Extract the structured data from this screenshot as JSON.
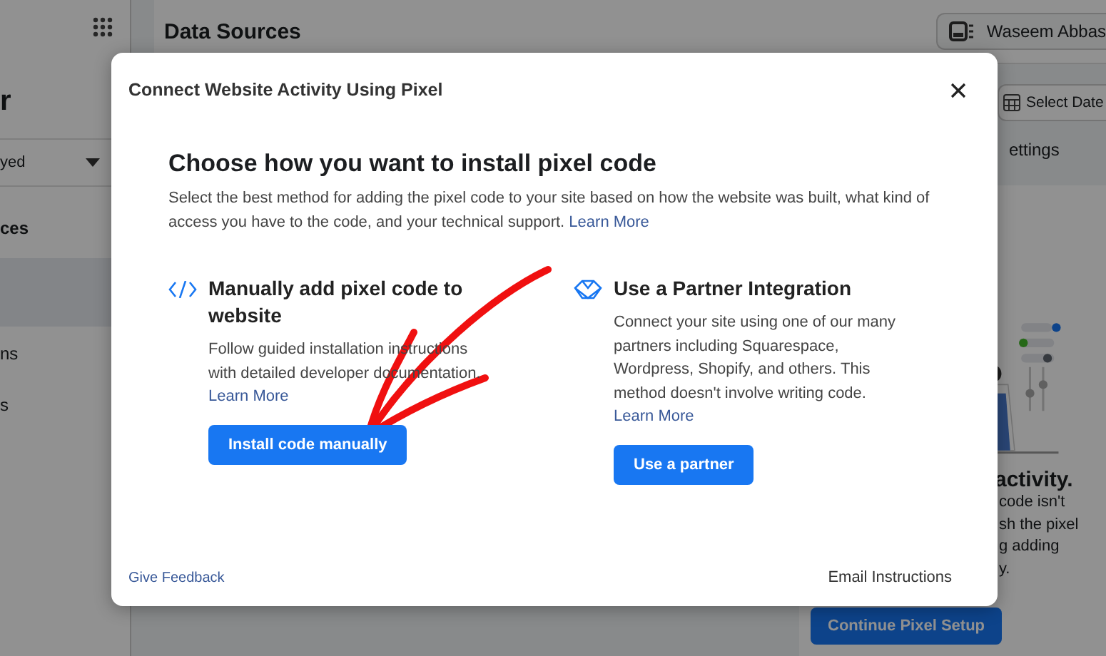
{
  "header": {
    "title": "Data Sources",
    "account": "Waseem Abbas"
  },
  "sidebar": {
    "title": "r",
    "dropdown": "yed",
    "section": "ces",
    "items": [
      {
        "label": "ns"
      },
      {
        "label": "s"
      }
    ]
  },
  "toolbar": {
    "date_button": "Select Date",
    "tab": "ettings"
  },
  "panel": {
    "heading": "activity.",
    "lines": [
      "code isn't",
      "sh the pixel",
      "g adding",
      "y."
    ],
    "button": "Continue Pixel Setup"
  },
  "dialog": {
    "title": "Connect Website Activity Using Pixel",
    "heading": "Choose how you want to install pixel code",
    "intro": "Select the best method for adding the pixel code to your site based on how the website was built, what kind of access you have to the code, and your technical support.",
    "intro_link": "Learn More",
    "options": [
      {
        "kind": "code",
        "title": "Manually add pixel code to website",
        "text": "Follow guided installation instructions with detailed developer documentation.",
        "link": "Learn More",
        "button": "Install code manually"
      },
      {
        "kind": "partner",
        "title": "Use a Partner Integration",
        "text": "Connect your site using one of our many partners including Squarespace, Wordpress, Shopify, and others. This method doesn't involve writing code.",
        "link": "Learn More",
        "button": "Use a partner"
      }
    ],
    "footer_link": "Give Feedback",
    "footer_button": "Email Instructions"
  }
}
